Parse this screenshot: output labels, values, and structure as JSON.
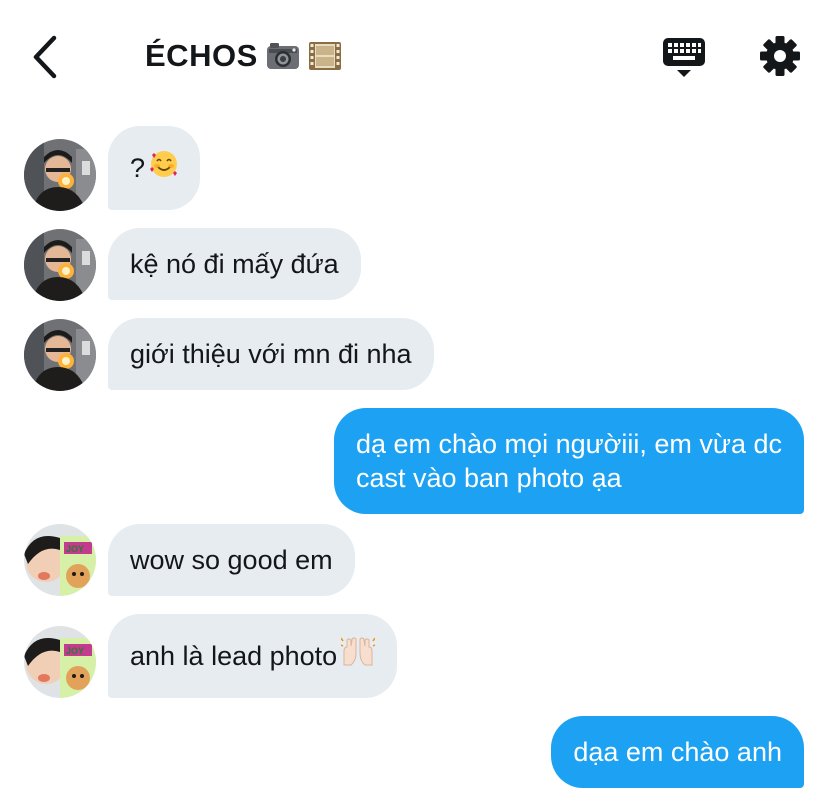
{
  "header": {
    "title": "ÉCHOS",
    "title_emojis": [
      "camera-emoji",
      "film-frames-emoji"
    ],
    "back_icon": "chevron-left-icon",
    "keyboard_icon": "keyboard-icon",
    "settings_icon": "gear-icon"
  },
  "colors": {
    "outgoing_bubble": "#1da1f2",
    "incoming_bubble": "#e6ecf0",
    "text": "#14171a"
  },
  "messages": [
    {
      "direction": "in",
      "sender": "user-1",
      "text": "?",
      "emoji": "smiling-face-with-hearts-emoji"
    },
    {
      "direction": "in",
      "sender": "user-1",
      "text": "kệ nó đi mấy đứa"
    },
    {
      "direction": "in",
      "sender": "user-1",
      "text": "giới thiệu với mn đi nha"
    },
    {
      "direction": "out",
      "lines": [
        "dạ em chào mọi ngườiii, em vừa dc",
        "cast vào ban photo ạa"
      ]
    },
    {
      "direction": "in",
      "sender": "user-2",
      "text": "wow so good em"
    },
    {
      "direction": "in",
      "sender": "user-2",
      "text": "anh là lead photo",
      "emoji": "raising-hands-emoji"
    },
    {
      "direction": "out",
      "text": "dạa em chào anh"
    }
  ]
}
